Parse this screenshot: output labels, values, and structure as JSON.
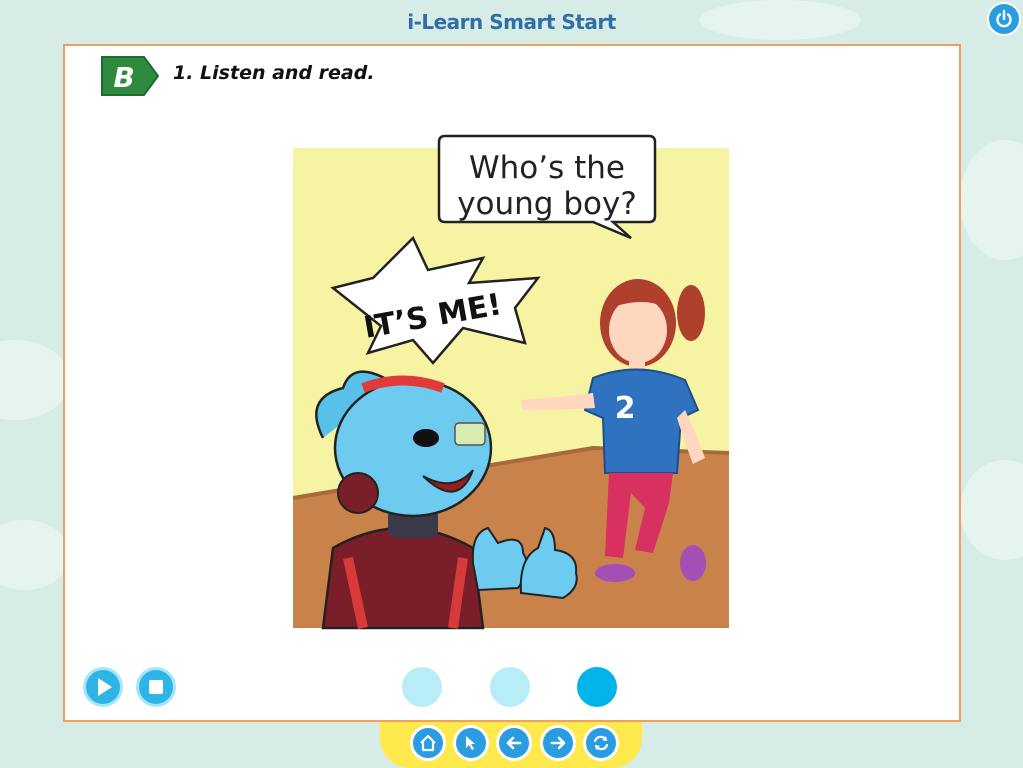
{
  "app": {
    "title": "i-Learn Smart Start"
  },
  "section": {
    "letter": "B",
    "instruction": "1. Listen and read."
  },
  "scene": {
    "speech_bubble": "Who’s the\nyoung boy?",
    "burst_text": "IT’S ME!",
    "shirt_number": "2"
  },
  "audio_controls": [
    {
      "name": "play-icon"
    },
    {
      "name": "stop-icon"
    }
  ],
  "page_dots": [
    {
      "state": "inactive",
      "color": "#b8ecf7"
    },
    {
      "state": "inactive",
      "color": "#b8ecf7"
    },
    {
      "state": "active",
      "color": "#00b4ea"
    }
  ],
  "nav_buttons": [
    {
      "name": "home-icon"
    },
    {
      "name": "pointer-icon"
    },
    {
      "name": "back-arrow-icon"
    },
    {
      "name": "forward-arrow-icon"
    },
    {
      "name": "refresh-icon"
    }
  ],
  "colors": {
    "title": "#2f6fa5",
    "accent": "#2a9ce0",
    "panel_border": "#f0a05a",
    "badge": "#2e8b3e",
    "navbar": "#ffe94d"
  }
}
